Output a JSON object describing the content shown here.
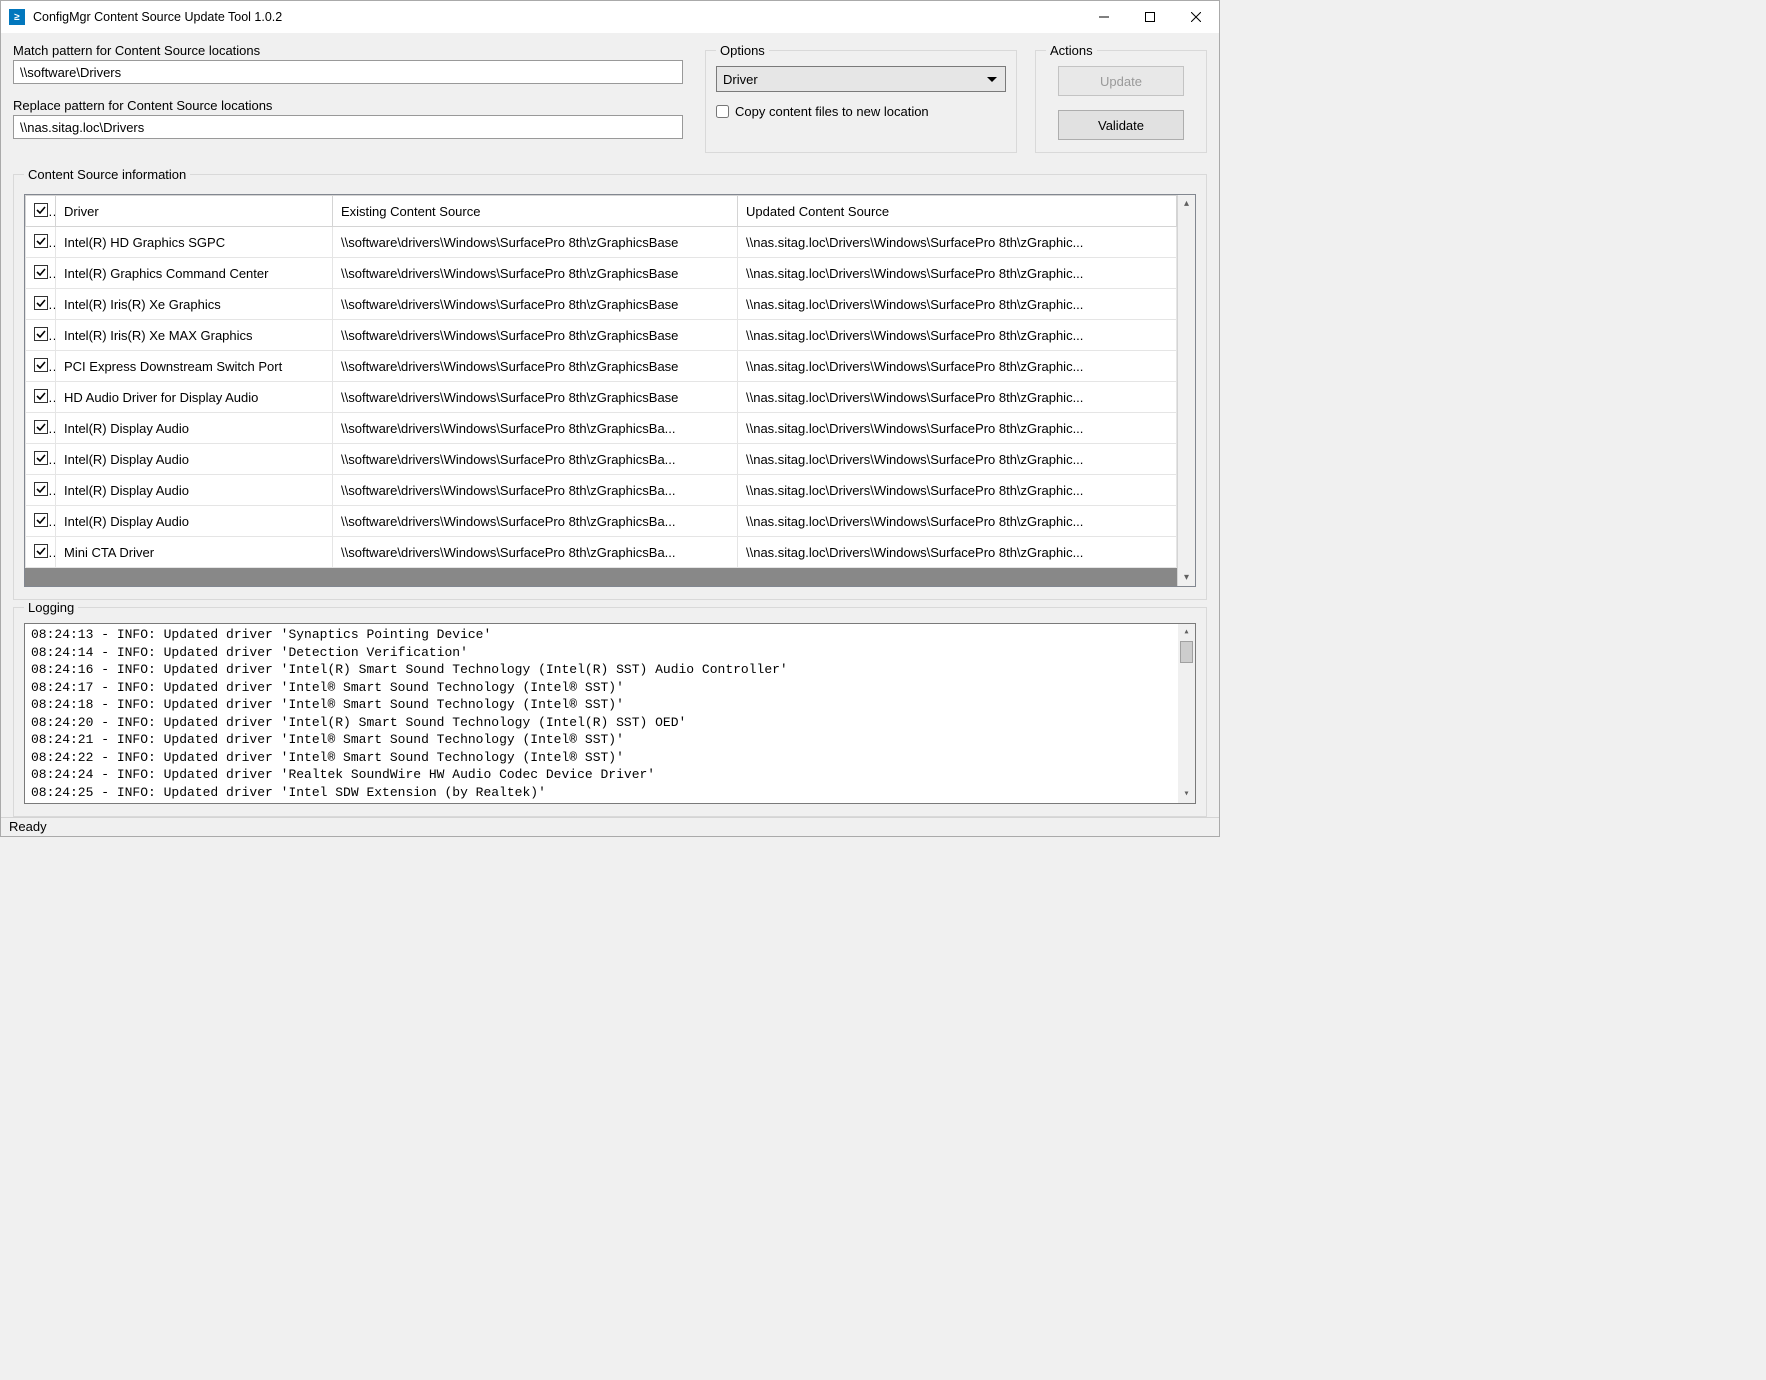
{
  "window": {
    "title": "ConfigMgr Content Source Update Tool 1.0.2",
    "icon_glyph": "≥"
  },
  "match": {
    "label": "Match pattern for Content Source locations",
    "value": "\\\\software\\Drivers"
  },
  "replace": {
    "label": "Replace pattern for Content Source locations",
    "value": "\\\\nas.sitag.loc\\Drivers"
  },
  "options": {
    "legend": "Options",
    "selected": "Driver",
    "copy_label": "Copy content files to new location",
    "copy_checked": false
  },
  "actions": {
    "legend": "Actions",
    "update_label": "Update",
    "validate_label": "Validate"
  },
  "grid": {
    "legend": "Content Source information",
    "headers": {
      "driver": "Driver",
      "existing": "Existing Content Source",
      "updated": "Updated Content Source"
    },
    "rows": [
      {
        "checked": true,
        "driver": "Intel(R) HD Graphics SGPC",
        "existing": "\\\\software\\drivers\\Windows\\SurfacePro 8th\\zGraphicsBase",
        "updated": "\\\\nas.sitag.loc\\Drivers\\Windows\\SurfacePro 8th\\zGraphic..."
      },
      {
        "checked": true,
        "driver": "Intel(R) Graphics Command Center",
        "existing": "\\\\software\\drivers\\Windows\\SurfacePro 8th\\zGraphicsBase",
        "updated": "\\\\nas.sitag.loc\\Drivers\\Windows\\SurfacePro 8th\\zGraphic..."
      },
      {
        "checked": true,
        "driver": "Intel(R) Iris(R) Xe Graphics",
        "existing": "\\\\software\\drivers\\Windows\\SurfacePro 8th\\zGraphicsBase",
        "updated": "\\\\nas.sitag.loc\\Drivers\\Windows\\SurfacePro 8th\\zGraphic..."
      },
      {
        "checked": true,
        "driver": "Intel(R) Iris(R) Xe MAX Graphics",
        "existing": "\\\\software\\drivers\\Windows\\SurfacePro 8th\\zGraphicsBase",
        "updated": "\\\\nas.sitag.loc\\Drivers\\Windows\\SurfacePro 8th\\zGraphic..."
      },
      {
        "checked": true,
        "driver": "PCI Express Downstream Switch Port",
        "existing": "\\\\software\\drivers\\Windows\\SurfacePro 8th\\zGraphicsBase",
        "updated": "\\\\nas.sitag.loc\\Drivers\\Windows\\SurfacePro 8th\\zGraphic..."
      },
      {
        "checked": true,
        "driver": "HD Audio Driver for Display Audio",
        "existing": "\\\\software\\drivers\\Windows\\SurfacePro 8th\\zGraphicsBase",
        "updated": "\\\\nas.sitag.loc\\Drivers\\Windows\\SurfacePro 8th\\zGraphic..."
      },
      {
        "checked": true,
        "driver": "Intel(R) Display Audio",
        "existing": "\\\\software\\drivers\\Windows\\SurfacePro 8th\\zGraphicsBa...",
        "updated": "\\\\nas.sitag.loc\\Drivers\\Windows\\SurfacePro 8th\\zGraphic..."
      },
      {
        "checked": true,
        "driver": "Intel(R) Display Audio",
        "existing": "\\\\software\\drivers\\Windows\\SurfacePro 8th\\zGraphicsBa...",
        "updated": "\\\\nas.sitag.loc\\Drivers\\Windows\\SurfacePro 8th\\zGraphic..."
      },
      {
        "checked": true,
        "driver": "Intel(R) Display Audio",
        "existing": "\\\\software\\drivers\\Windows\\SurfacePro 8th\\zGraphicsBa...",
        "updated": "\\\\nas.sitag.loc\\Drivers\\Windows\\SurfacePro 8th\\zGraphic..."
      },
      {
        "checked": true,
        "driver": "Intel(R) Display Audio",
        "existing": "\\\\software\\drivers\\Windows\\SurfacePro 8th\\zGraphicsBa...",
        "updated": "\\\\nas.sitag.loc\\Drivers\\Windows\\SurfacePro 8th\\zGraphic..."
      },
      {
        "checked": true,
        "driver": "Mini CTA Driver",
        "existing": "\\\\software\\drivers\\Windows\\SurfacePro 8th\\zGraphicsBa...",
        "updated": "\\\\nas.sitag.loc\\Drivers\\Windows\\SurfacePro 8th\\zGraphic..."
      }
    ]
  },
  "logging": {
    "legend": "Logging",
    "lines": [
      "08:24:13 - INFO: Updated driver 'Synaptics Pointing Device'",
      "08:24:14 - INFO: Updated driver 'Detection Verification'",
      "08:24:16 - INFO: Updated driver 'Intel(R) Smart Sound Technology (Intel(R) SST) Audio Controller'",
      "08:24:17 - INFO: Updated driver 'Intel® Smart Sound Technology (Intel® SST)'",
      "08:24:18 - INFO: Updated driver 'Intel® Smart Sound Technology (Intel® SST)'",
      "08:24:20 - INFO: Updated driver 'Intel(R) Smart Sound Technology (Intel(R) SST) OED'",
      "08:24:21 - INFO: Updated driver 'Intel® Smart Sound Technology (Intel® SST)'",
      "08:24:22 - INFO: Updated driver 'Intel® Smart Sound Technology (Intel® SST)'",
      "08:24:24 - INFO: Updated driver 'Realtek SoundWire HW Audio Codec Device Driver'",
      "08:24:25 - INFO: Updated driver 'Intel SDW Extension (by Realtek)'"
    ]
  },
  "status": {
    "text": "Ready"
  }
}
